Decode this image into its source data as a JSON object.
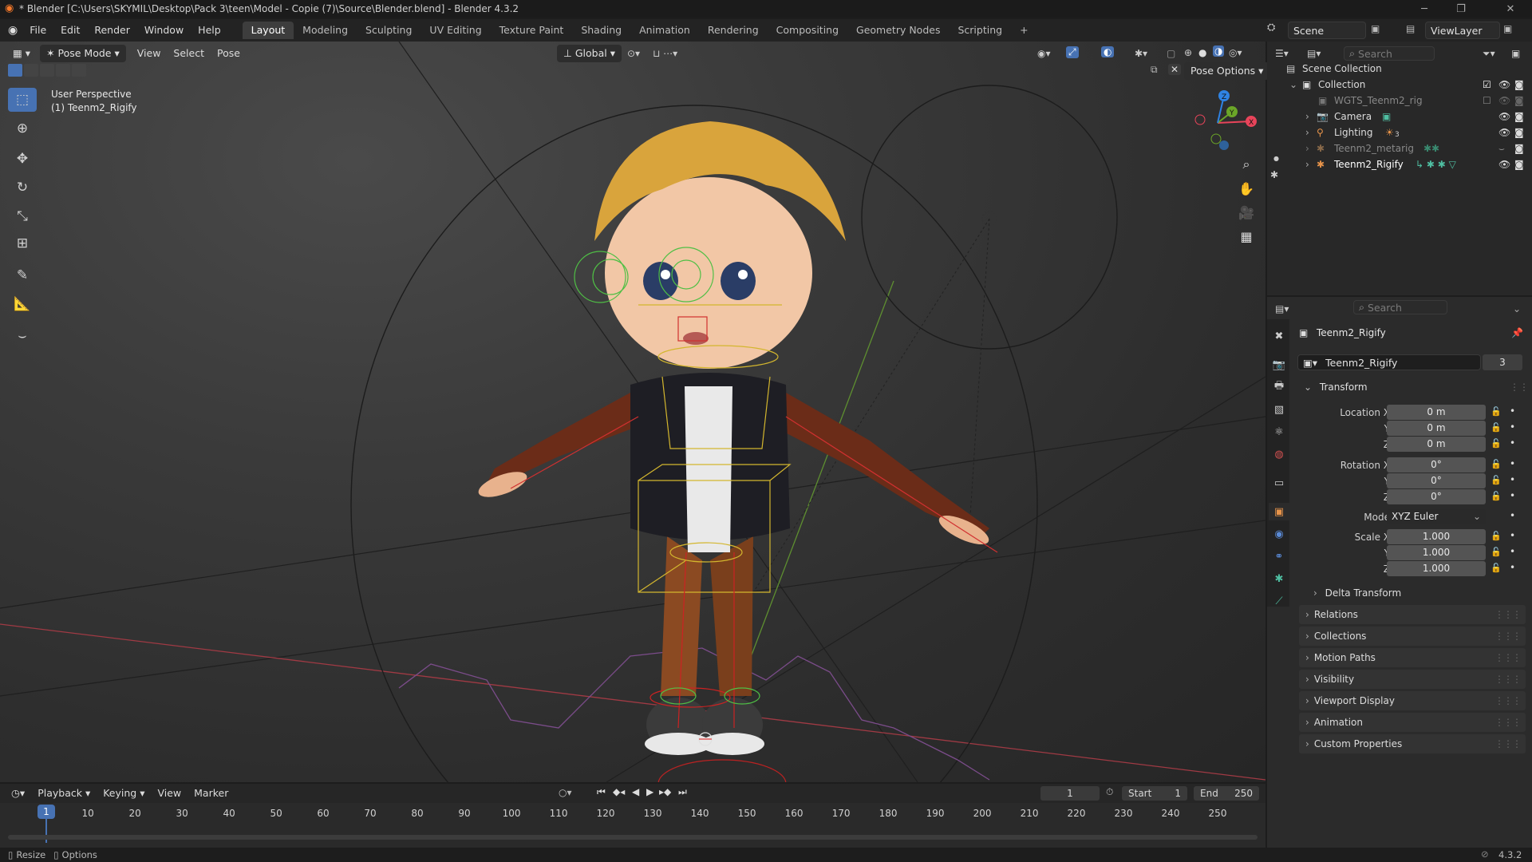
{
  "title_bar": {
    "title": "* Blender [C:\\Users\\SKYMIL\\Desktop\\Pack 3\\teen\\Model - Copie (7)\\Source\\Blender.blend] - Blender 4.3.2",
    "minimize": "─",
    "maximize": "❐",
    "close": "✕"
  },
  "menu": [
    "File",
    "Edit",
    "Render",
    "Window",
    "Help"
  ],
  "workspaces": [
    "Layout",
    "Modeling",
    "Sculpting",
    "UV Editing",
    "Texture Paint",
    "Shading",
    "Animation",
    "Rendering",
    "Compositing",
    "Geometry Nodes",
    "Scripting"
  ],
  "workspace_add": "+",
  "scene": {
    "label": "Scene",
    "view_layer": "ViewLayer"
  },
  "viewport_header": {
    "mode": "Pose Mode",
    "menus": [
      "View",
      "Select",
      "Pose"
    ],
    "orientation": "Global",
    "pose_options": "Pose Options"
  },
  "viewport_overlay_text": {
    "perspective": "User Perspective",
    "object": "(1) Teenm2_Rigify"
  },
  "gizmo": {
    "x": "X",
    "y": "Y",
    "z": "Z"
  },
  "outliner": {
    "search_placeholder": "Search",
    "scene_collection": "Scene Collection",
    "items": [
      {
        "name": "Collection",
        "indent": 1
      },
      {
        "name": "WGTS_Teenm2_rig",
        "indent": 2
      },
      {
        "name": "Camera",
        "indent": 2
      },
      {
        "name": "Lighting",
        "indent": 2
      },
      {
        "name": "Teenm2_metarig",
        "indent": 2
      },
      {
        "name": "Teenm2_Rigify",
        "indent": 2
      }
    ],
    "lighting_badge": "3"
  },
  "properties": {
    "search_placeholder": "Search",
    "object_name": "Teenm2_Rigify",
    "datablock_name": "Teenm2_Rigify",
    "user_count": "3",
    "transform_title": "Transform",
    "location": {
      "label_x": "Location X",
      "label_y": "Y",
      "label_z": "Z",
      "x": "0 m",
      "y": "0 m",
      "z": "0 m"
    },
    "rotation": {
      "label_x": "Rotation X",
      "label_y": "Y",
      "label_z": "Z",
      "x": "0°",
      "y": "0°",
      "z": "0°"
    },
    "mode_label": "Mode",
    "mode_value": "XYZ Euler",
    "scale": {
      "label_x": "Scale X",
      "label_y": "Y",
      "label_z": "Z",
      "x": "1.000",
      "y": "1.000",
      "z": "1.000"
    },
    "delta_transform": "Delta Transform",
    "panels": [
      "Relations",
      "Collections",
      "Motion Paths",
      "Visibility",
      "Viewport Display",
      "Animation",
      "Custom Properties"
    ]
  },
  "timeline": {
    "menus": [
      "Playback",
      "Keying",
      "View",
      "Marker"
    ],
    "current_frame": "1",
    "start_label": "Start",
    "start": "1",
    "end_label": "End",
    "end": "250",
    "ruler": [
      "1",
      "10",
      "20",
      "30",
      "40",
      "50",
      "60",
      "70",
      "80",
      "90",
      "100",
      "110",
      "120",
      "130",
      "140",
      "150",
      "160",
      "170",
      "180",
      "190",
      "200",
      "210",
      "220",
      "230",
      "240",
      "250"
    ]
  },
  "status_bar": {
    "left1": "Resize",
    "left2": "Options",
    "version": "4.3.2"
  },
  "colors": {
    "accent": "#4772b3",
    "selected_row": "#334d80",
    "axis_x": "#e8445a",
    "axis_y": "#6ba628",
    "axis_z": "#2f83e3"
  }
}
